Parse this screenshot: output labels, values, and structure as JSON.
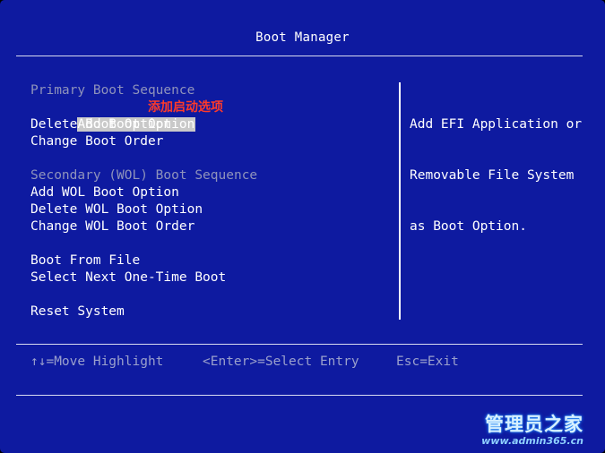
{
  "title": "Boot Manager",
  "menu": {
    "primary_header": "Primary Boot Sequence",
    "add_boot_option": "Add Boot Option",
    "annotation": "添加启动选项",
    "delete_boot_option": "Delete Boot Option",
    "change_boot_order": "Change Boot Order",
    "secondary_header": "Secondary (WOL) Boot Sequence",
    "add_wol_boot_option": "Add WOL Boot Option",
    "delete_wol_boot_option": "Delete WOL Boot Option",
    "change_wol_boot_order": "Change WOL Boot Order",
    "boot_from_file": "Boot From File",
    "select_next_one_time_boot": "Select Next One-Time Boot",
    "reset_system": "Reset System"
  },
  "help": {
    "line1": "Add EFI Application or",
    "line2": "Removable File System",
    "line3": "as Boot Option."
  },
  "footer": {
    "move": "↑↓=Move Highlight",
    "select": "<Enter>=Select Entry",
    "exit": "Esc=Exit"
  },
  "watermark": {
    "main": "管理员之家",
    "sub": "www.admin365.cn"
  },
  "colors": {
    "background": "#0e1aa0",
    "text": "#ffffff",
    "header_text": "#8f93bb",
    "highlight": "#c9c9c9",
    "annotation": "#ff3a2a"
  }
}
